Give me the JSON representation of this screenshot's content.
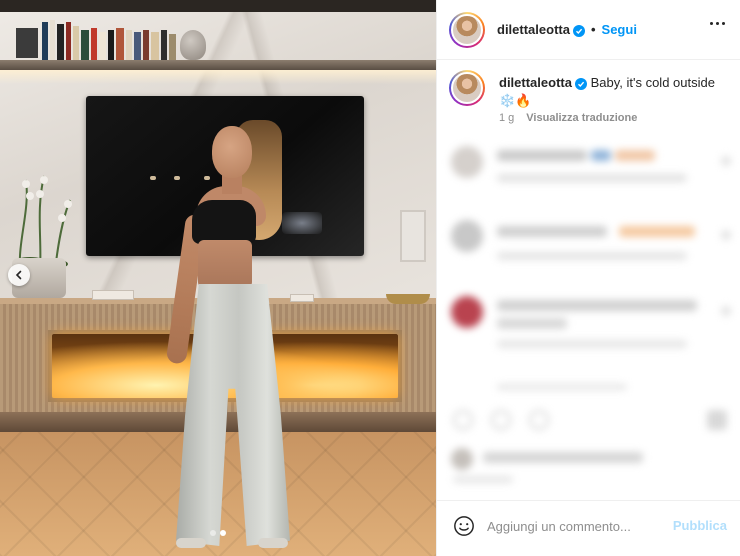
{
  "post": {
    "username": "dilettaleotta",
    "verified": true,
    "separator": "•",
    "follow_label": "Segui",
    "caption_text": "Baby, it's cold outside",
    "caption_emojis": "❄️🔥",
    "time_ago": "1 g",
    "translate_label": "Visualizza traduzione"
  },
  "carousel": {
    "total": 2,
    "active_index": 1
  },
  "comment_box": {
    "placeholder": "Aggiungi un commento...",
    "publish_label": "Pubblica"
  },
  "colors": {
    "link": "#0095f6",
    "publish_disabled": "#b2dffc",
    "muted": "#8e8e8e",
    "text": "#262626"
  },
  "icons": {
    "verified": "verified-badge-icon",
    "more": "more-options-icon",
    "prev": "chevron-left-icon",
    "emoji": "emoji-icon"
  }
}
